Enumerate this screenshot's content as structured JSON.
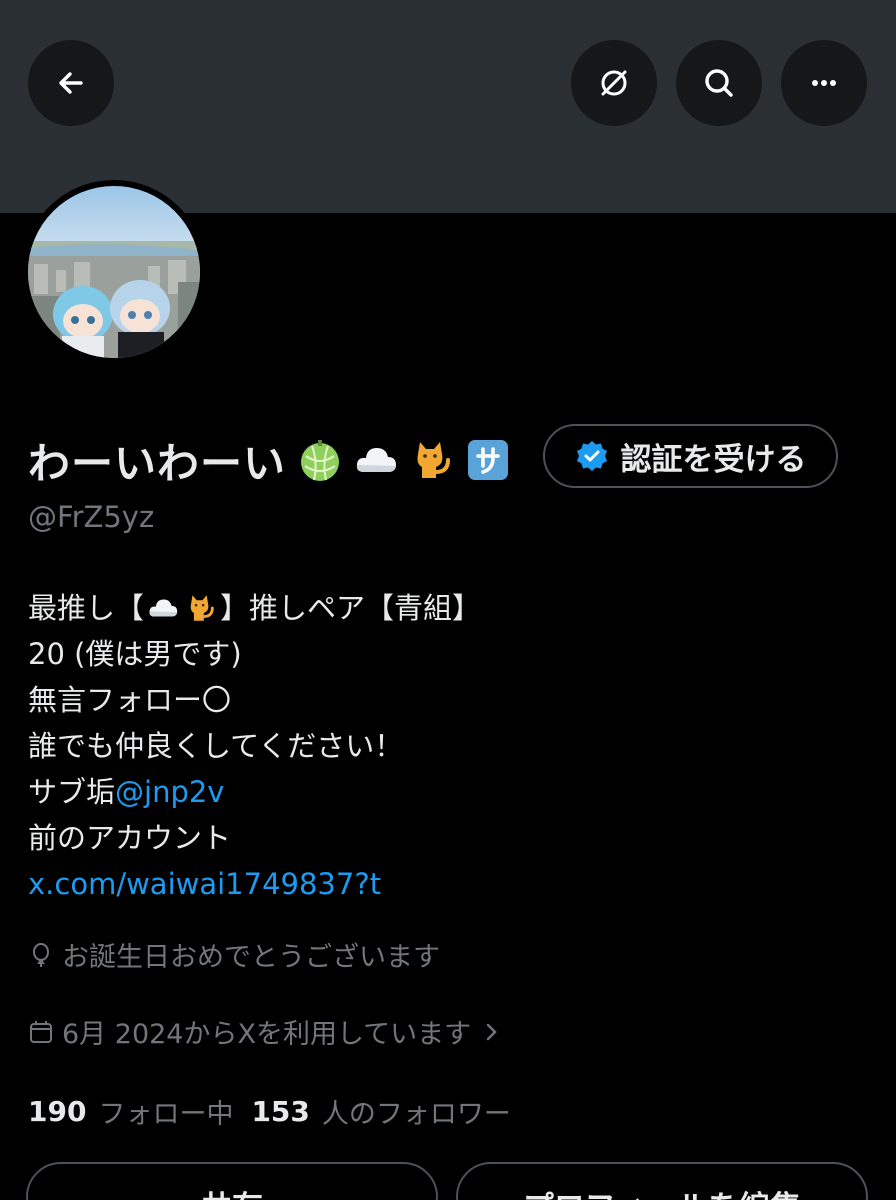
{
  "header": {
    "back_icon": "arrow-left-icon",
    "grok_icon": "grok-icon",
    "search_icon": "search-icon",
    "more_icon": "more-horizontal-icon",
    "banner_color": "#2a2f34"
  },
  "profile": {
    "display_name": "わーいわーい",
    "name_emojis": [
      "melon",
      "cloud",
      "cat",
      "sa-button"
    ],
    "handle": "@FrZ5yz",
    "verify_button_label": "認証を受ける",
    "verify_icon": "verified-badge-icon"
  },
  "bio": {
    "line1_a": "最推し【",
    "line1_b": "】推しペア【青組】",
    "line2": "20 (僕は男です)",
    "line3": "無言フォロー〇",
    "line4": "誰でも仲良くしてください！",
    "line5_text": "サブ垢",
    "line5_link": "@jnp2v",
    "line6": "前のアカウント",
    "line7_link": "x.com/waiwai1749837?t"
  },
  "meta": {
    "birthday_icon": "balloon-icon",
    "birthday_text": "お誕生日おめでとうございます",
    "joined_icon": "calendar-icon",
    "joined_text": "6月 2024からXを利用しています",
    "joined_chevron": "chevron-right-icon"
  },
  "stats": {
    "following_count": "190",
    "following_label": "フォロー中",
    "followers_count": "153",
    "followers_label": "人のフォロワー"
  },
  "actions": {
    "share_label": "共有",
    "edit_label": "プロフィールを編集"
  },
  "colors": {
    "background": "#000000",
    "text_primary": "#e7e9ea",
    "text_secondary": "#71767b",
    "link": "#1d9bf0",
    "border": "#4c5257"
  }
}
